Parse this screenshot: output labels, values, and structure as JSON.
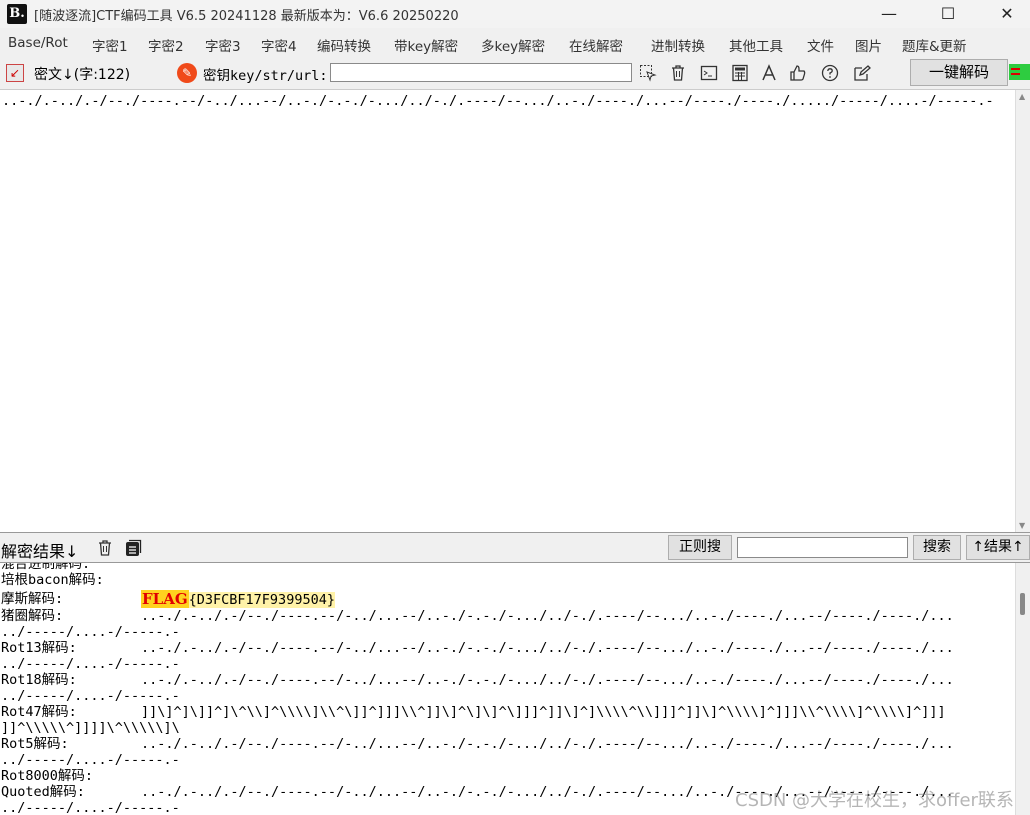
{
  "window": {
    "title": "[随波逐流]CTF编码工具 V6.5 20241128     最新版本为：V6.6 20250220",
    "logo_text": "B.",
    "minimize_glyph": "—",
    "maximize_glyph": "☐",
    "close_glyph": "✕"
  },
  "menu": {
    "items": [
      "Base/Rot",
      "字密1",
      "字密2",
      "字密3",
      "字密4",
      "编码转换",
      "带key解密",
      "多key解密",
      "在线解密",
      "进制转换",
      "其他工具",
      "文件",
      "图片",
      "题库&更新"
    ]
  },
  "toolbar": {
    "cipher_label": "密文↓(字:122)",
    "key_label": "密钥key/str/url:",
    "key_value": "",
    "decode_button": "一键解码",
    "icons": [
      "select-icon",
      "trash-icon",
      "terminal-icon",
      "calculator-icon",
      "font-icon",
      "thumbs-up-icon",
      "help-icon",
      "edit-icon"
    ]
  },
  "cipher": {
    "text": "..-./.-../.-/--./----.--/-../...--/..-./-.-./-.../../-./.----/--.../..-./----./...--/----./----./...../-----/....-/-----.-"
  },
  "results_bar": {
    "label": "解密结果↓",
    "regex_button": "正则搜",
    "search_value": "",
    "search_button": "搜索",
    "result_up_button": "↑结果↑"
  },
  "results": [
    {
      "label": "混合进制解码:",
      "lines": [
        ""
      ]
    },
    {
      "label": "培根bacon解码:",
      "lines": [
        ""
      ]
    },
    {
      "label": "摩斯解码:",
      "flag_prefix": "FLAG",
      "flag_rest": "{D3FCBF17F9399504}",
      "lines": []
    },
    {
      "label": "猪圈解码:",
      "lines": [
        "..-./.-../.-/--./----.--/-../...--/..-./-.-./-.../../-./.----/--.../..-./----./...--/----./----./...",
        "../-----/....-/-----.-"
      ]
    },
    {
      "label": "Rot13解码:",
      "lines": [
        "..-./.-../.-/--./----.--/-../...--/..-./-.-./-.../../-./.----/--.../..-./----./...--/----./----./...",
        "../-----/....-/-----.-"
      ]
    },
    {
      "label": "Rot18解码:",
      "lines": [
        "..-./.-../.-/--./----.--/-../...--/..-./-.-./-.../../-./.----/--.../..-./----./...--/----./----./...",
        "../-----/....-/-----.-"
      ]
    },
    {
      "label": "Rot47解码:",
      "lines": [
        "]]\\]^]\\]]^]\\^\\\\]^\\\\\\\\]\\\\^\\]]^]]]\\\\^]]\\]^\\]\\]^\\]]]^]]\\]^]\\\\\\\\^\\\\]]]^]]\\]^\\\\\\\\]^]]]\\\\^\\\\\\\\]^\\\\\\\\]^]]]",
        "]]^\\\\\\\\\\^]]]]\\^\\\\\\\\\\]\\"
      ]
    },
    {
      "label": "Rot5解码:",
      "lines": [
        "..-./.-../.-/--./----.--/-../...--/..-./-.-./-.../../-./.----/--.../..-./----./...--/----./----./...",
        "../-----/....-/-----.-"
      ]
    },
    {
      "label": "Rot8000解码:",
      "lines": [
        ""
      ]
    },
    {
      "label": "Quoted解码:",
      "lines": [
        "..-./.-../.-/--./----.--/-../...--/..-./-.-./-.../../-./.----/--.../..-./----./...--/----./----./...",
        "../-----/....-/-----.-"
      ]
    }
  ],
  "watermark": "CSDN @大学在校生，求offer联系"
}
